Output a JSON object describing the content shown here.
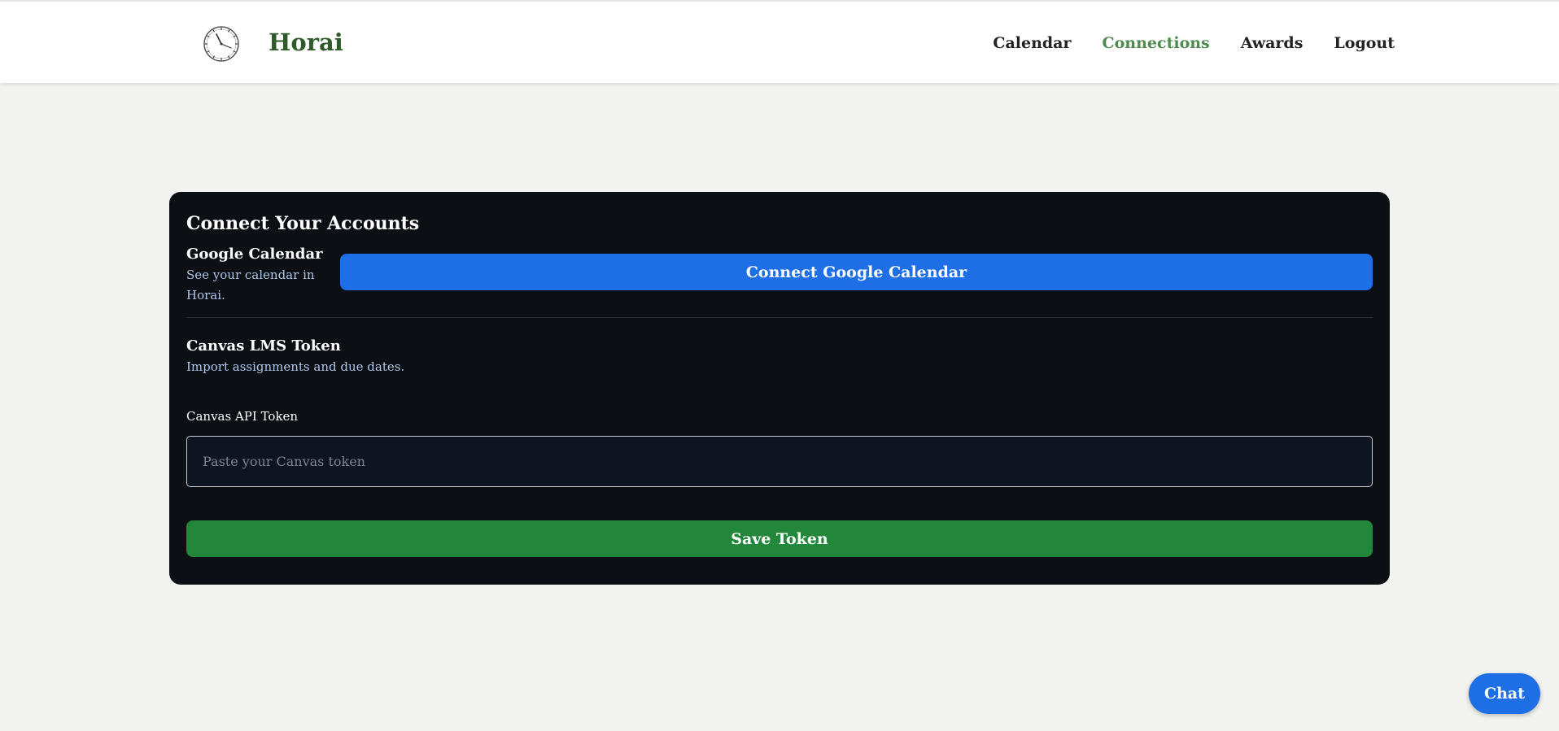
{
  "header": {
    "brand": "Horai",
    "logo_icon": "clock-icon",
    "nav": [
      {
        "label": "Calendar"
      },
      {
        "label": "Connections"
      },
      {
        "label": "Awards"
      },
      {
        "label": "Logout"
      }
    ],
    "active_nav": "Connections"
  },
  "card": {
    "title": "Connect Your Accounts",
    "google": {
      "title": "Google Calendar",
      "description": "See your calendar in Horai.",
      "button_label": "Connect Google Calendar"
    },
    "canvas": {
      "title": "Canvas LMS Token",
      "description": "Import assignments and due dates.",
      "field_label": "Canvas API Token",
      "input_value": "",
      "input_placeholder": "Paste your Canvas token",
      "button_label": "Save Token"
    }
  },
  "chat": {
    "label": "Chat"
  },
  "colors": {
    "brand_green": "#2f5a2a",
    "active_nav": "#4e8a4e",
    "card_bg": "#0c0f14",
    "primary_blue": "#1e6ee5",
    "save_green": "#22873a",
    "page_bg": "#f2f3f1"
  }
}
